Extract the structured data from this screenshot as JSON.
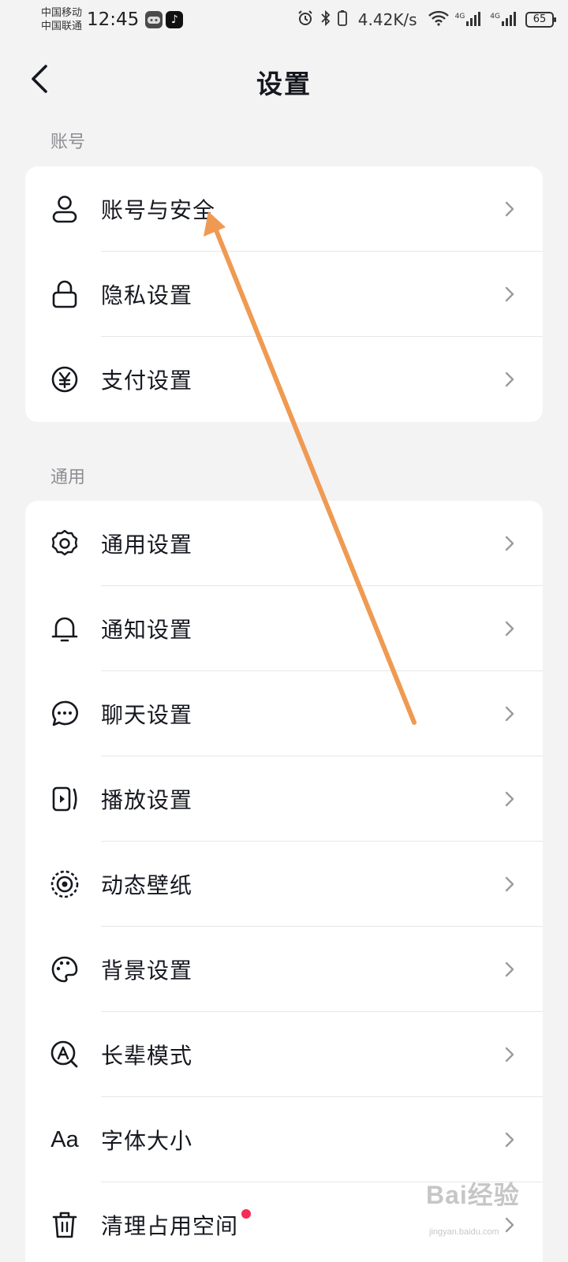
{
  "status_bar": {
    "carrier_1": "中国移动",
    "carrier_2": "中国联通",
    "time": "12:45",
    "net_speed": "4.42K/s",
    "signal_tag_1": "4G",
    "signal_tag_2": "4G",
    "battery": "65"
  },
  "header": {
    "title": "设置"
  },
  "sections": {
    "account": {
      "label": "账号",
      "items": [
        {
          "label": "账号与安全",
          "icon": "person-icon"
        },
        {
          "label": "隐私设置",
          "icon": "lock-icon"
        },
        {
          "label": "支付设置",
          "icon": "yen-icon"
        }
      ]
    },
    "general": {
      "label": "通用",
      "items": [
        {
          "label": "通用设置",
          "icon": "gear-icon"
        },
        {
          "label": "通知设置",
          "icon": "bell-icon"
        },
        {
          "label": "聊天设置",
          "icon": "chat-bubble-icon"
        },
        {
          "label": "播放设置",
          "icon": "play-screen-icon"
        },
        {
          "label": "动态壁纸",
          "icon": "dynamic-wallpaper-icon"
        },
        {
          "label": "背景设置",
          "icon": "palette-icon"
        },
        {
          "label": "长辈模式",
          "icon": "elder-mode-icon"
        },
        {
          "label": "字体大小",
          "icon": "font-size-icon",
          "icon_text": "Aa"
        },
        {
          "label": "清理占用空间",
          "icon": "trash-icon",
          "has_red_dot": true
        }
      ]
    }
  },
  "colors": {
    "background": "#f3f3f4",
    "card": "#ffffff",
    "text": "#16181f",
    "section_label": "#8d8d93",
    "red_dot": "#f52b56",
    "annotation_arrow": "#ef9a52"
  },
  "watermark": {
    "text": "Bai经验",
    "sub": "jingyan.baidu.com"
  }
}
